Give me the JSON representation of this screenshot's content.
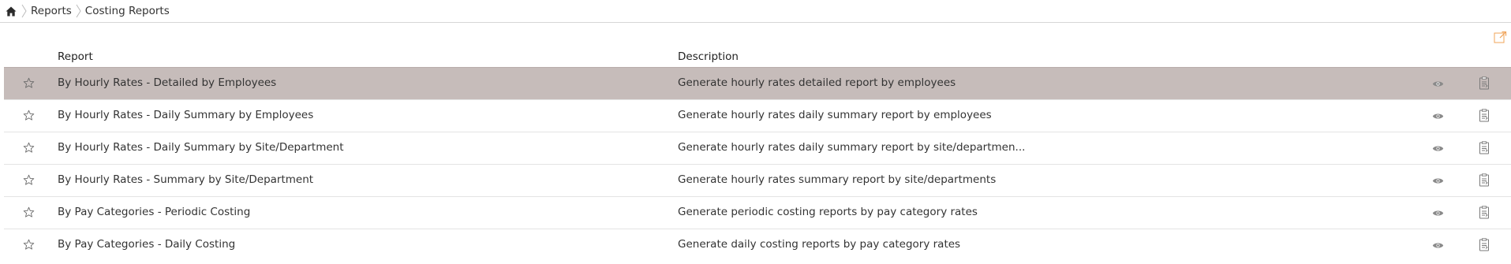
{
  "breadcrumb": {
    "home_icon": "home-icon",
    "items": [
      "Reports",
      "Costing Reports"
    ]
  },
  "toolbar": {
    "export_icon": "export-icon",
    "accent_color": "#f0a45a"
  },
  "table": {
    "columns": {
      "report": "Report",
      "description": "Description"
    },
    "selected_row_color": "#c6bcba",
    "rows": [
      {
        "name": "By Hourly Rates - Detailed by Employees",
        "description": "Generate hourly rates detailed report by employees",
        "selected": true
      },
      {
        "name": "By Hourly Rates - Daily Summary by Employees",
        "description": "Generate hourly rates daily summary report by employees",
        "selected": false
      },
      {
        "name": "By Hourly Rates - Daily Summary by Site/Department",
        "description": "Generate hourly rates daily summary report by site/departmen...",
        "selected": false
      },
      {
        "name": "By Hourly Rates - Summary by Site/Department",
        "description": "Generate hourly rates summary report by site/departments",
        "selected": false
      },
      {
        "name": "By Pay Categories - Periodic Costing",
        "description": "Generate periodic costing reports by pay category rates",
        "selected": false
      },
      {
        "name": "By Pay Categories - Daily Costing",
        "description": "Generate daily costing reports by pay category rates",
        "selected": false
      }
    ],
    "row_icons": [
      "star-icon",
      "eye-icon",
      "generate-report-icon"
    ]
  }
}
